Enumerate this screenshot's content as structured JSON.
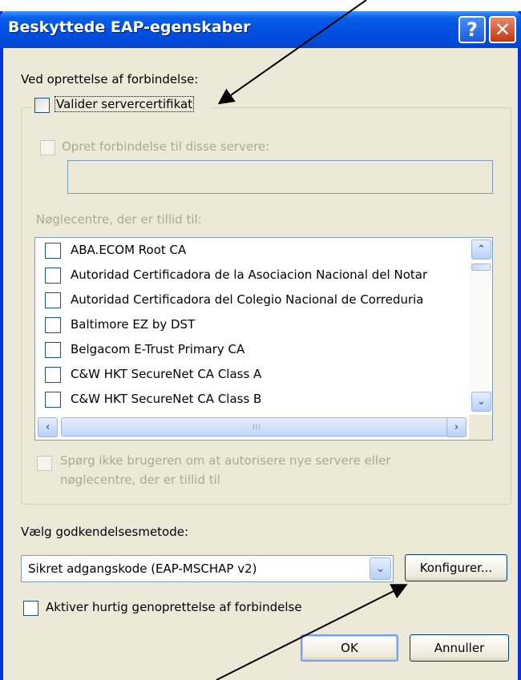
{
  "window": {
    "title": "Beskyttede EAP-egenskaber"
  },
  "titlebar_buttons": {
    "help": "?",
    "close": "✕"
  },
  "connect_section": {
    "label": "Ved oprettelse af forbindelse:"
  },
  "validate_cert": {
    "label": "Valider servercertifikat",
    "checked": false
  },
  "connect_servers": {
    "label": "Opret forbindelse til disse servere:",
    "value": ""
  },
  "trusted_ca": {
    "label": "Nøglecentre, der er tillid til:",
    "items": [
      {
        "label": "ABA.ECOM Root CA",
        "checked": false
      },
      {
        "label": "Autoridad Certificadora de la Asociacion Nacional del Notar",
        "checked": false
      },
      {
        "label": "Autoridad Certificadora del Colegio Nacional de Correduria",
        "checked": false
      },
      {
        "label": "Baltimore EZ by DST",
        "checked": false
      },
      {
        "label": "Belgacom E-Trust Primary CA",
        "checked": false
      },
      {
        "label": "C&W HKT SecureNet CA Class A",
        "checked": false
      },
      {
        "label": "C&W HKT SecureNet CA Class B",
        "checked": false
      }
    ]
  },
  "scrollbar": {
    "grip": "III"
  },
  "dont_prompt": {
    "line1": "Spørg ikke brugeren om at autorisere nye servere eller",
    "line2": "nøglecentre, der er tillid til"
  },
  "auth_method": {
    "label": "Vælg godkendelsesmetode:",
    "selected": "Sikret adgangskode (EAP-MSCHAP v2)",
    "configure_label": "Konfigurer..."
  },
  "fast_reconnect": {
    "label": "Aktiver hurtig genoprettelse af forbindelse",
    "checked": false
  },
  "buttons": {
    "ok": "OK",
    "cancel": "Annuller"
  },
  "colors": {
    "titlebar": "#0050e0",
    "dialog_bg": "#ece9d8",
    "frame": "#0831d9",
    "close_btn": "#c1370f"
  }
}
